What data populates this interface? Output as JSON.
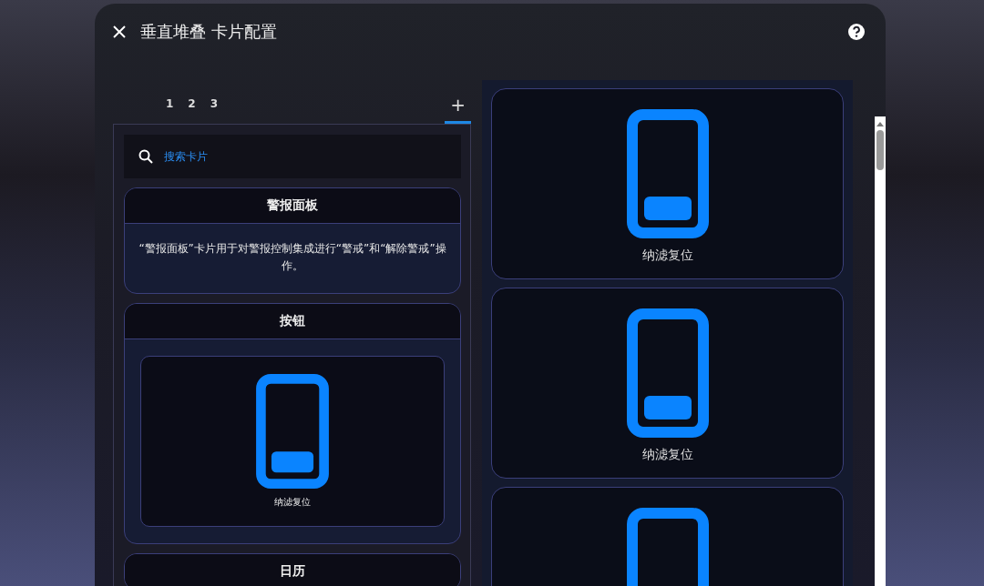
{
  "dialog": {
    "title": "垂直堆叠 卡片配置"
  },
  "tabs": [
    {
      "label": "1",
      "selected": false
    },
    {
      "label": "2",
      "selected": false
    },
    {
      "label": "3",
      "selected": false
    },
    {
      "label": "+",
      "selected": true
    }
  ],
  "search": {
    "placeholder": "搜索卡片"
  },
  "card_types": [
    {
      "kind": "description",
      "title": "警报面板",
      "description": "“警报面板”卡片用于对警报控制集成进行“警戒”和“解除警戒”操作。"
    },
    {
      "kind": "preview",
      "title": "按钮",
      "preview_label": "纳滤复位"
    },
    {
      "kind": "title_only",
      "title": "日历"
    }
  ],
  "stack_cards": [
    {
      "kind": "labeled",
      "label": "纳滤复位"
    },
    {
      "kind": "labeled",
      "label": "纳滤复位"
    },
    {
      "kind": "unlabeled"
    }
  ]
}
